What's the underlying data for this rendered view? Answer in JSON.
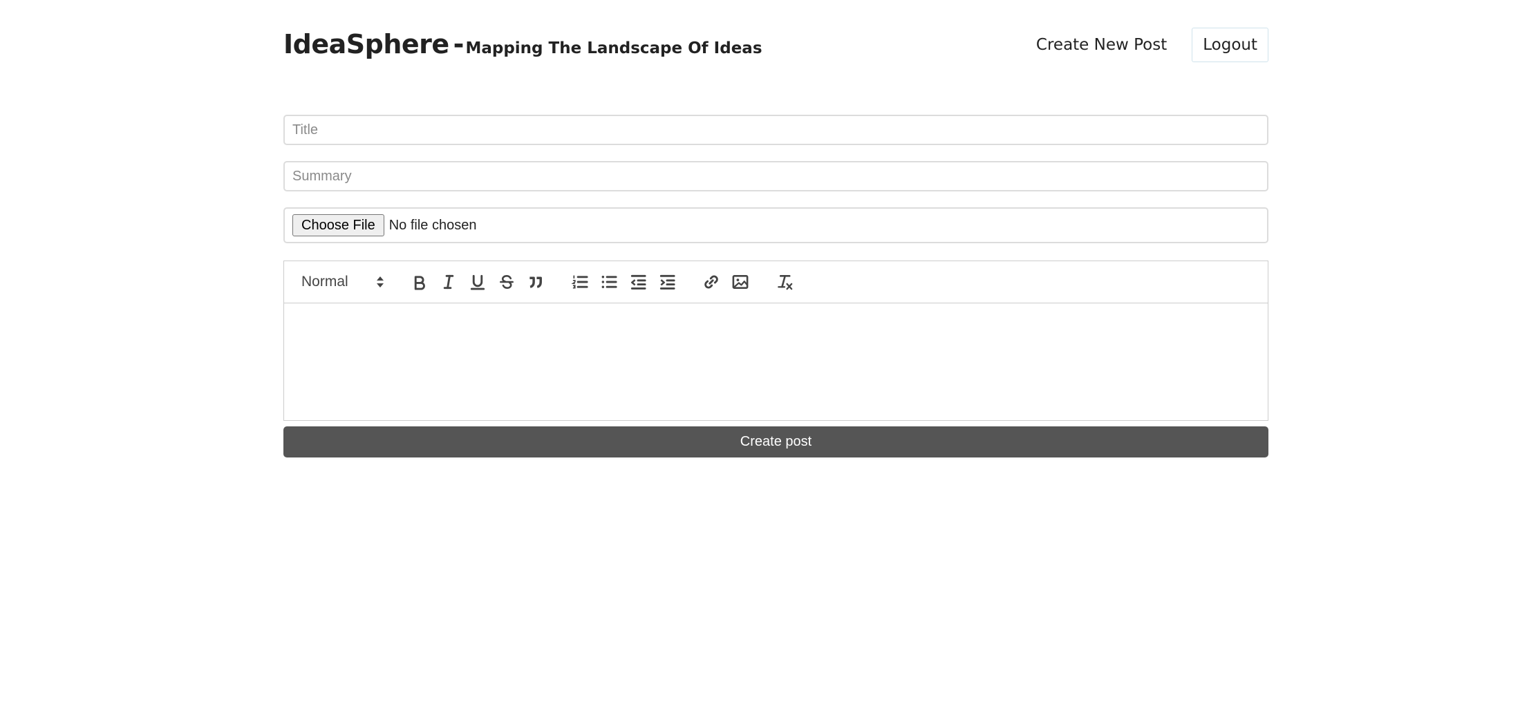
{
  "brand": {
    "name": "IdeaSphere",
    "separator": "-",
    "tagline": "Mapping The Landscape Of Ideas"
  },
  "nav": {
    "create_post": "Create New Post",
    "logout": "Logout"
  },
  "form": {
    "title_placeholder": "Title",
    "title_value": "",
    "summary_placeholder": "Summary",
    "summary_value": "",
    "file_button": "Choose File",
    "file_status": "No file chosen",
    "editor": {
      "header_select": "Normal",
      "toolbar_icons": [
        "bold-icon",
        "italic-icon",
        "underline-icon",
        "strike-icon",
        "blockquote-icon",
        "ordered-list-icon",
        "bullet-list-icon",
        "outdent-icon",
        "indent-icon",
        "link-icon",
        "image-icon",
        "clean-format-icon"
      ],
      "content": ""
    },
    "submit": "Create post"
  },
  "colors": {
    "submit_bg": "#555555",
    "text": "#222222",
    "border": "#dcdcdc"
  }
}
